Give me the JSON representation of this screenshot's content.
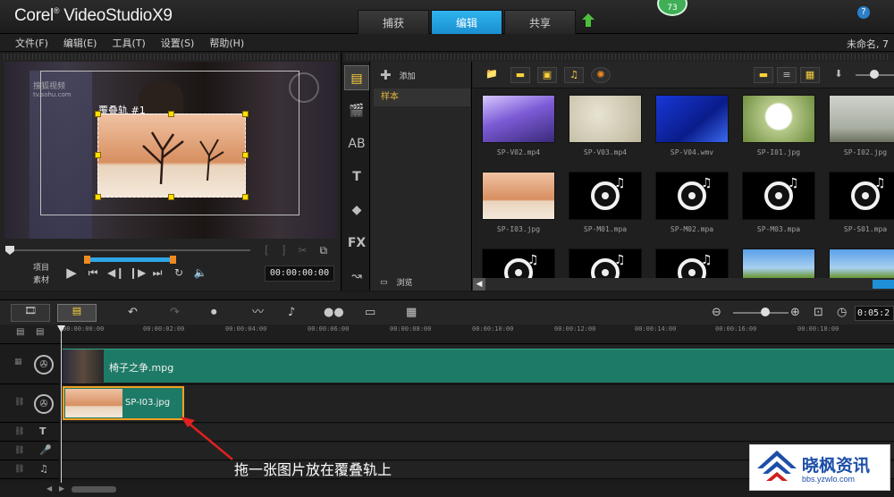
{
  "app": {
    "title": "Corel VideoStudio X9",
    "brand": "Corel",
    "product": "VideoStudio",
    "version": "X9",
    "badge_count": "73",
    "project_name": "未命名, 7"
  },
  "tabs": [
    {
      "label": "捕获",
      "active": false
    },
    {
      "label": "编辑",
      "active": true
    },
    {
      "label": "共享",
      "active": false
    }
  ],
  "menu": [
    "文件(F)",
    "编辑(E)",
    "工具(T)",
    "设置(S)",
    "帮助(H)"
  ],
  "preview": {
    "watermark": "搜狐视频",
    "watermark_sub": "tv.sohu.com",
    "overlay_label": "覆叠轨 #1",
    "mode_labels": [
      "项目",
      "素材"
    ],
    "timecode": "00:00:00:00"
  },
  "library": {
    "add_label": "添加",
    "folder": "样本",
    "browse_label": "浏览",
    "items": [
      {
        "name": "SP-V02.mp4",
        "kind": "video-purple"
      },
      {
        "name": "SP-V03.mp4",
        "kind": "video-beige"
      },
      {
        "name": "SP-V04.wmv",
        "kind": "video-blue"
      },
      {
        "name": "SP-I01.jpg",
        "kind": "image-dandelion"
      },
      {
        "name": "SP-I02.jpg",
        "kind": "image-tree"
      },
      {
        "name": "SP-I03.jpg",
        "kind": "image-desert"
      },
      {
        "name": "SP-M01.mpa",
        "kind": "audio"
      },
      {
        "name": "SP-M02.mpa",
        "kind": "audio"
      },
      {
        "name": "SP-M03.mpa",
        "kind": "audio"
      },
      {
        "name": "SP-S01.mpa",
        "kind": "audio"
      },
      {
        "name": "",
        "kind": "audio"
      },
      {
        "name": "",
        "kind": "audio"
      },
      {
        "name": "",
        "kind": "audio"
      },
      {
        "name": "",
        "kind": "image-field"
      },
      {
        "name": "",
        "kind": "image-field"
      }
    ]
  },
  "timeline": {
    "project_time": "0:05:2",
    "ruler": [
      "00:00:00:00",
      "00:00:02:00",
      "00:00:04:00",
      "00:00:06:00",
      "00:00:08:00",
      "00:00:10:00",
      "00:00:12:00",
      "00:00:14:00",
      "00:00:16:00",
      "00:00:18:00"
    ],
    "video_clip": "椅子之争.mpg",
    "overlay_clip": "SP-I03.jpg"
  },
  "annotation": "拖一张图片放在覆叠轨上",
  "site": {
    "name": "晓枫资讯",
    "url": "bbs.yzwlo.com"
  },
  "colors": {
    "accent": "#1e9ee0",
    "clip": "#1d7a66",
    "overlay_border": "#f0a020",
    "handle": "#ffe000"
  }
}
